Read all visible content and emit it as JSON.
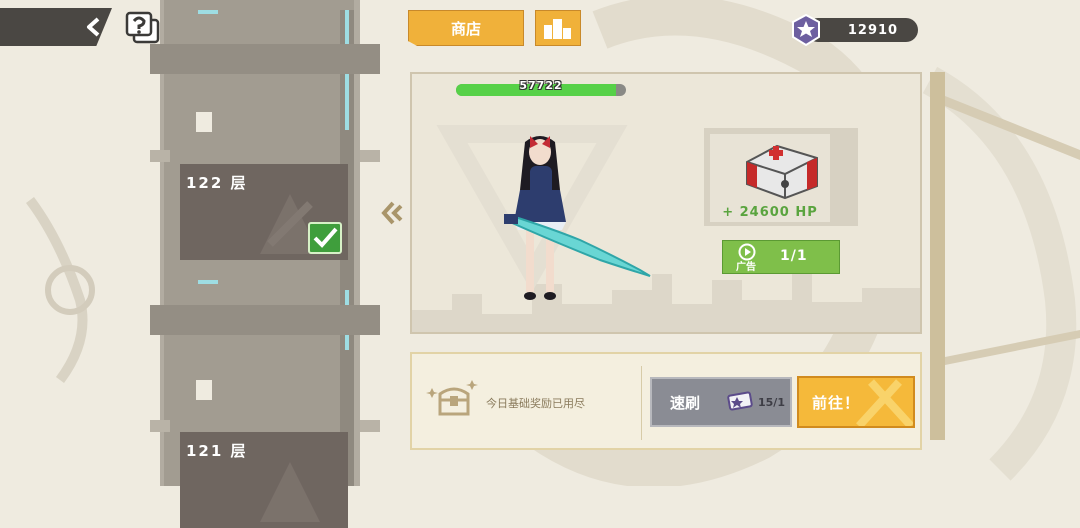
{
  "nav": {
    "back_icon": "chevron-left-icon",
    "help_icon": "help-bubble-icon"
  },
  "tower": {
    "floors": [
      {
        "label": "122 层",
        "completed": true
      },
      {
        "label": "121 层",
        "completed": false
      }
    ]
  },
  "topbar": {
    "shop_label": "商店",
    "rank_icon": "podium-icon",
    "currency_value": "12910",
    "currency_icon": "star-medal-icon"
  },
  "battle": {
    "enemy_hp": "57722",
    "enemy_hp_fraction": 0.94,
    "heal_bonus": "+ 24600 HP",
    "ad_label": "广告",
    "ad_uses": "1/1"
  },
  "bottom": {
    "daily_status": "今日基础奖励已用尽",
    "sweep_label": "速刷",
    "sweep_count": "15/1",
    "go_label": "前往！"
  },
  "colors": {
    "accent": "#f0b13a",
    "hp_green": "#57d148",
    "check_green": "#3f9e3c"
  }
}
